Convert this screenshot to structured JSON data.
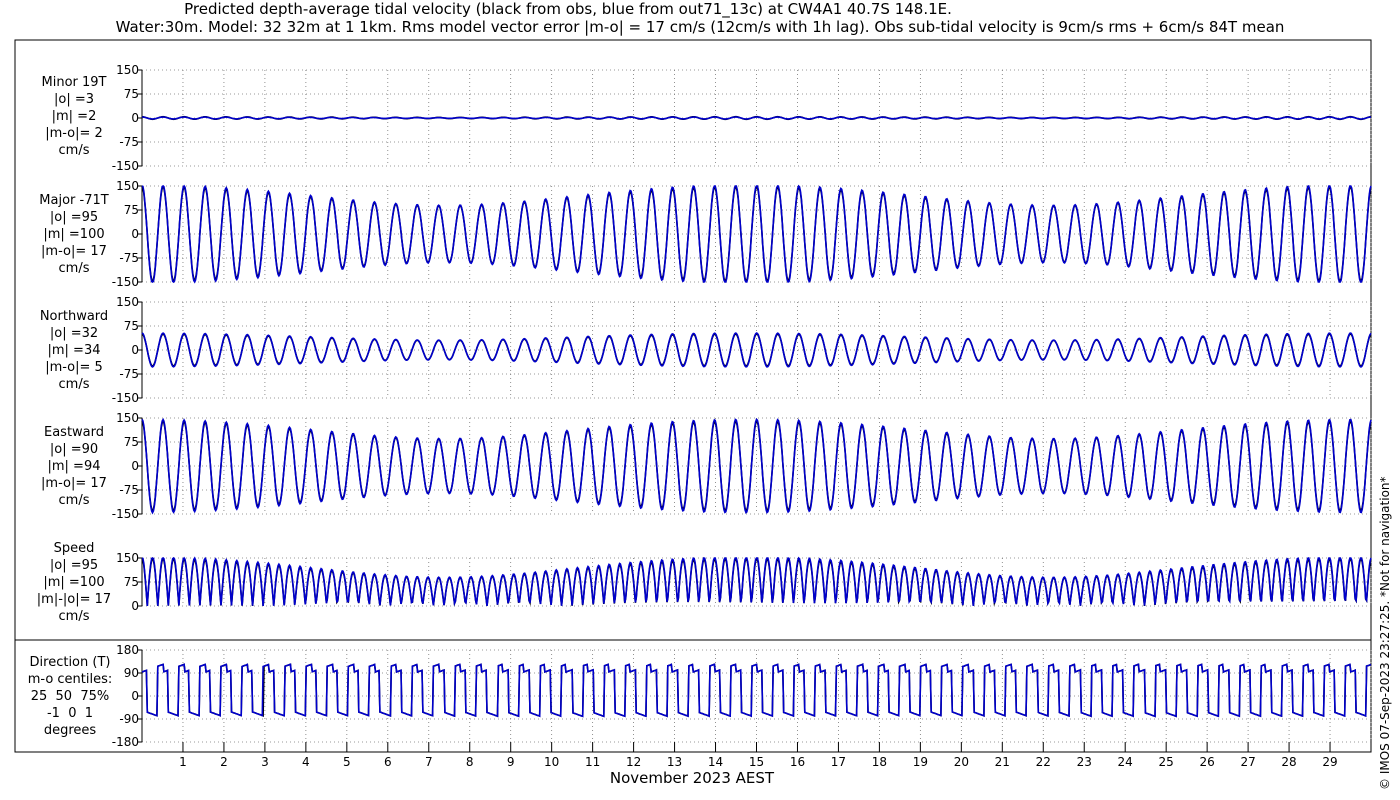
{
  "header": {
    "title_line1": "Predicted depth-average tidal velocity (black from obs, blue from out71_13c) at CW4A1 40.7S 148.1E.",
    "title_line2": "Water:30m. Model: 32 32m at 1 1km. Rms model vector error |m-o| = 17 cm/s (12cm/s with 1h lag). Obs sub-tidal velocity is 9cm/s rms + 6cm/s 84T mean"
  },
  "footer": {
    "xlabel": "November 2023 AEST",
    "copyright": "© IMOS 07-Sep-2023 23:27:25. *Not for navigation*"
  },
  "colors": {
    "obs": "#000000",
    "model": "#0000cc",
    "grid": "#777777"
  },
  "chart_data": [
    {
      "type": "line",
      "panel": "minor",
      "label_lines": [
        "Minor 19T",
        "|o| =3",
        "|m| =2",
        "|m-o|= 2",
        "cm/s"
      ],
      "ylim": [
        -150,
        150
      ],
      "yticks": [
        -150,
        -75,
        0,
        75,
        150
      ],
      "amplitude_obs": 3,
      "amplitude_model": 2,
      "series": [
        {
          "name": "obs",
          "constituents": [
            {
              "period_h": 12.42,
              "amp": 3
            },
            {
              "period_h": 12.0,
              "amp": 1
            }
          ]
        },
        {
          "name": "model",
          "constituents": [
            {
              "period_h": 12.42,
              "amp": 2
            },
            {
              "period_h": 12.0,
              "amp": 1
            }
          ]
        }
      ]
    },
    {
      "type": "line",
      "panel": "major",
      "label_lines": [
        "Major -71T",
        "|o| =95",
        "|m| =100",
        "|m-o|= 17",
        "cm/s"
      ],
      "ylim": [
        -150,
        150
      ],
      "yticks": [
        -150,
        -75,
        0,
        75,
        150
      ],
      "series": [
        {
          "name": "obs",
          "constituents": [
            {
              "period_h": 12.42,
              "amp": 118
            },
            {
              "period_h": 12.0,
              "amp": 30
            }
          ]
        },
        {
          "name": "model",
          "constituents": [
            {
              "period_h": 12.42,
              "amp": 122
            },
            {
              "period_h": 12.0,
              "amp": 32
            }
          ]
        }
      ]
    },
    {
      "type": "line",
      "panel": "northward",
      "label_lines": [
        "Northward",
        "|o| =32",
        "|m| =34",
        "|m-o|= 5",
        "cm/s"
      ],
      "ylim": [
        -150,
        150
      ],
      "yticks": [
        -150,
        -75,
        0,
        75,
        150
      ],
      "series": [
        {
          "name": "obs",
          "constituents": [
            {
              "period_h": 12.42,
              "amp": 40
            },
            {
              "period_h": 12.0,
              "amp": 10
            }
          ]
        },
        {
          "name": "model",
          "constituents": [
            {
              "period_h": 12.42,
              "amp": 42
            },
            {
              "period_h": 12.0,
              "amp": 11
            }
          ]
        }
      ]
    },
    {
      "type": "line",
      "panel": "eastward",
      "label_lines": [
        "Eastward",
        "|o| =90",
        "|m| =94",
        "|m-o|= 17",
        "cm/s"
      ],
      "ylim": [
        -150,
        150
      ],
      "yticks": [
        -150,
        -75,
        0,
        75,
        150
      ],
      "series": [
        {
          "name": "obs",
          "constituents": [
            {
              "period_h": 12.42,
              "amp": 112
            },
            {
              "period_h": 12.0,
              "amp": 28
            }
          ]
        },
        {
          "name": "model",
          "constituents": [
            {
              "period_h": 12.42,
              "amp": 116
            },
            {
              "period_h": 12.0,
              "amp": 30
            }
          ]
        }
      ]
    },
    {
      "type": "line",
      "panel": "speed",
      "label_lines": [
        "Speed",
        "|o| =95",
        "|m| =100",
        "|m|-|o|= 17",
        "cm/s"
      ],
      "ylim": [
        0,
        150
      ],
      "yticks": [
        0,
        75,
        150
      ],
      "series": [
        {
          "name": "obs",
          "constituents": [
            {
              "period_h": 12.42,
              "amp": 118
            },
            {
              "period_h": 12.0,
              "amp": 30
            }
          ]
        },
        {
          "name": "model",
          "constituents": [
            {
              "period_h": 12.42,
              "amp": 122
            },
            {
              "period_h": 12.0,
              "amp": 32
            }
          ]
        }
      ]
    },
    {
      "type": "line",
      "panel": "direction",
      "label_lines": [
        "Direction (T)",
        "m-o centiles:",
        "25  50  75%",
        "-1  0  1",
        "degrees"
      ],
      "ylim": [
        -180,
        180
      ],
      "yticks": [
        -180,
        -90,
        0,
        90,
        180
      ],
      "flood_direction_deg": 109,
      "ebb_direction_deg": -71,
      "series": [
        {
          "name": "obs"
        },
        {
          "name": "model"
        }
      ]
    }
  ],
  "x_axis": {
    "days_shown": 30,
    "tick_labels": [
      "1",
      "2",
      "3",
      "4",
      "5",
      "6",
      "7",
      "8",
      "9",
      "10",
      "11",
      "12",
      "13",
      "14",
      "15",
      "16",
      "17",
      "18",
      "19",
      "20",
      "21",
      "22",
      "23",
      "24",
      "25",
      "26",
      "27",
      "28",
      "29"
    ]
  }
}
